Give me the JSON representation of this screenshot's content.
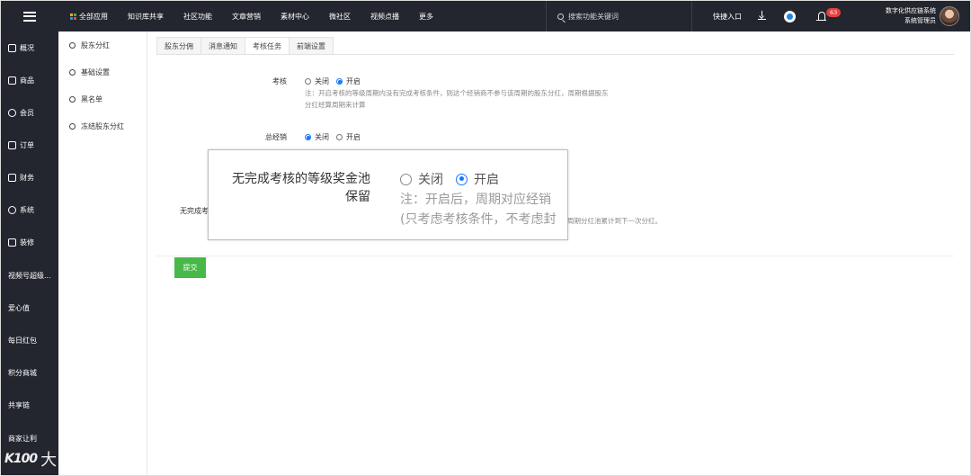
{
  "topnav": {
    "items": [
      "全部应用",
      "知识库共享",
      "社区功能",
      "文章营销",
      "素材中心",
      "微社区",
      "视频点播",
      "更多"
    ]
  },
  "search": {
    "placeholder": "搜索功能关键词"
  },
  "header": {
    "quick_entry": "快捷入口",
    "notification_count": "63",
    "system_name": "数字化供应链系统",
    "user_role": "系统管理员"
  },
  "sidebar": {
    "items": [
      "概况",
      "商品",
      "会员",
      "订单",
      "财务",
      "系统",
      "装修",
      "视频号超级...",
      "爱心值",
      "每日红包",
      "积分商城",
      "共享链",
      "商家让利"
    ]
  },
  "subsidebar": {
    "items": [
      "股东分红",
      "基础设置",
      "黑名单",
      "冻结股东分红"
    ]
  },
  "tabs": [
    "股东分佣",
    "消息通知",
    "考核任务",
    "前端设置"
  ],
  "form": {
    "assessment": {
      "label": "考核",
      "options": [
        "关闭",
        "开启"
      ],
      "selected": "开启",
      "note_line1": "注：开启考核的等级周期内没有完成考核条件，则这个经销商不参与该周期的股东分红，周期根据股东",
      "note_line2": "分红经算周期来计算"
    },
    "general_distributor": {
      "label": "总经销",
      "options": [
        "关闭",
        "开启"
      ],
      "selected": "关闭"
    },
    "pool_keep": {
      "label_visible": "无完成考",
      "note_visible": "周期分红池累计到下一次分红。"
    },
    "submit_label": "提交"
  },
  "zoom": {
    "label_line1": "无完成考核的等级奖金池",
    "label_line2": "保留",
    "options": [
      "关闭",
      "开启"
    ],
    "selected": "开启",
    "note_line1": "注：开启后，周期对应经销",
    "note_line2": "(只考虑考核条件，不考虑封"
  },
  "watermark": {
    "text": "大数跨境"
  },
  "colors": {
    "accent": "#1677ff",
    "submit": "#48b848",
    "topbar": "#23262e",
    "badge": "#ea3e3e"
  }
}
